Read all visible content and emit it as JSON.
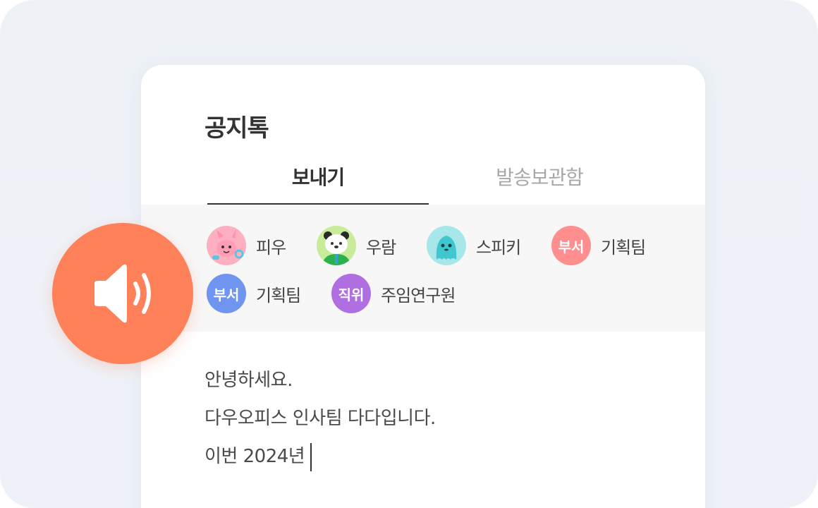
{
  "panel": {
    "title": "공지톡",
    "tabs": [
      {
        "label": "보내기",
        "active": true
      },
      {
        "label": "발송보관함",
        "active": false
      }
    ]
  },
  "recipients": [
    {
      "kind": "user",
      "name": "피우",
      "avatar": "pink-bunny-character",
      "color": "#ff9fb8"
    },
    {
      "kind": "user",
      "name": "우람",
      "avatar": "panda-character",
      "color": "#c8ec9a"
    },
    {
      "kind": "user",
      "name": "스피키",
      "avatar": "teal-blob-character",
      "color": "#a7e7ea"
    },
    {
      "kind": "group",
      "badge": "부서",
      "name": "기획팀",
      "color": "#ff8e8e"
    },
    {
      "kind": "group",
      "badge": "부서",
      "name": "기획팀",
      "color": "#6f95f0"
    },
    {
      "kind": "group",
      "badge": "직위",
      "name": "주임연구원",
      "color": "#b06fe0"
    }
  ],
  "message": {
    "lines": [
      "안녕하세요.",
      "다우오피스 인사팀 다다입니다.",
      "이번 2024년"
    ]
  },
  "colors": {
    "accent": "#ff8159",
    "text": "#333333",
    "muted": "#a8a8a8"
  },
  "icons": {
    "speaker": "speaker-volume-icon"
  }
}
